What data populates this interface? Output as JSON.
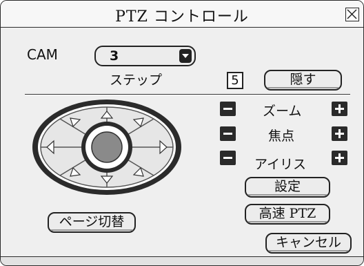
{
  "window": {
    "title": "PTZ コントロール",
    "close_label": "close"
  },
  "camera": {
    "label": "CAM",
    "selected": "3"
  },
  "step": {
    "label": "ステップ",
    "value": "5"
  },
  "buttons": {
    "hide": "隠す",
    "settings": "設定",
    "high_speed_ptz": "高速 PTZ",
    "cancel": "キャンセル",
    "page_switch": "ページ切替"
  },
  "adjust": [
    {
      "label": "ズーム",
      "minus": "−",
      "plus": "+"
    },
    {
      "label": "焦点",
      "minus": "−",
      "plus": "+"
    },
    {
      "label": "アイリス",
      "minus": "−",
      "plus": "+"
    }
  ],
  "pad": {
    "directions": [
      "up",
      "up-right",
      "right",
      "down-right",
      "down",
      "down-left",
      "left",
      "up-left"
    ],
    "center": "center"
  },
  "icons": {
    "close": "close-icon",
    "dropdown": "chevron-down-icon",
    "minus": "minus-icon",
    "plus": "plus-icon"
  }
}
